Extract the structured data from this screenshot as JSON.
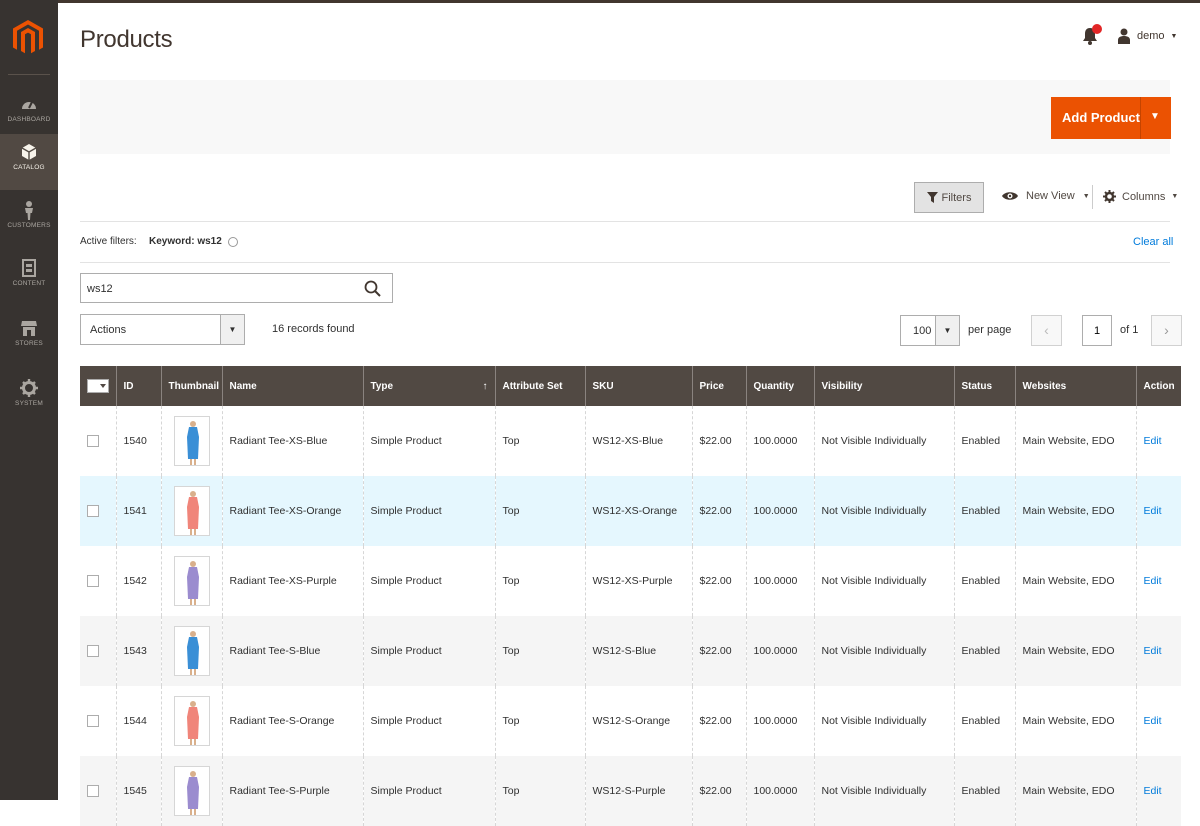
{
  "sidebar": {
    "items": [
      {
        "label": "DASHBOARD",
        "icon": "dashboard-icon",
        "active": false
      },
      {
        "label": "CATALOG",
        "icon": "catalog-icon",
        "active": true
      },
      {
        "label": "CUSTOMERS",
        "icon": "customers-icon",
        "active": false
      },
      {
        "label": "CONTENT",
        "icon": "content-icon",
        "active": false
      },
      {
        "label": "STORES",
        "icon": "stores-icon",
        "active": false
      },
      {
        "label": "SYSTEM",
        "icon": "system-icon",
        "active": false
      }
    ]
  },
  "header": {
    "title": "Products",
    "user": "demo"
  },
  "page_actions": {
    "add_product": "Add Product",
    "add_product_color": "#eb5202"
  },
  "toolbar": {
    "filters": "Filters",
    "view": "New View",
    "columns": "Columns"
  },
  "active_filters": {
    "label": "Active filters:",
    "filter_text": "Keyword: ws12",
    "clear_all": "Clear all"
  },
  "search": {
    "value": "ws12"
  },
  "grid_controls": {
    "actions": "Actions",
    "records": "16 records found",
    "per_page_value": "100",
    "per_page_label": "per page",
    "page_value": "1",
    "page_of": "of 1"
  },
  "table": {
    "columns": [
      "ID",
      "Thumbnail",
      "Name",
      "Type",
      "Attribute Set",
      "SKU",
      "Price",
      "Quantity",
      "Visibility",
      "Status",
      "Websites",
      "Action"
    ],
    "rows": [
      {
        "id": "1540",
        "color": "#3a8fd6",
        "name": "Radiant Tee-XS-Blue",
        "type": "Simple Product",
        "attr": "Top",
        "sku": "WS12-XS-Blue",
        "price": "$22.00",
        "qty": "100.0000",
        "visibility": "Not Visible Individually",
        "status": "Enabled",
        "websites": "Main Website, EDO",
        "action": "Edit"
      },
      {
        "id": "1541",
        "color": "#f0857a",
        "name": "Radiant Tee-XS-Orange",
        "type": "Simple Product",
        "attr": "Top",
        "sku": "WS12-XS-Orange",
        "price": "$22.00",
        "qty": "100.0000",
        "visibility": "Not Visible Individually",
        "status": "Enabled",
        "websites": "Main Website, EDO",
        "action": "Edit"
      },
      {
        "id": "1542",
        "color": "#9b8ccf",
        "name": "Radiant Tee-XS-Purple",
        "type": "Simple Product",
        "attr": "Top",
        "sku": "WS12-XS-Purple",
        "price": "$22.00",
        "qty": "100.0000",
        "visibility": "Not Visible Individually",
        "status": "Enabled",
        "websites": "Main Website, EDO",
        "action": "Edit"
      },
      {
        "id": "1543",
        "color": "#3a8fd6",
        "name": "Radiant Tee-S-Blue",
        "type": "Simple Product",
        "attr": "Top",
        "sku": "WS12-S-Blue",
        "price": "$22.00",
        "qty": "100.0000",
        "visibility": "Not Visible Individually",
        "status": "Enabled",
        "websites": "Main Website, EDO",
        "action": "Edit"
      },
      {
        "id": "1544",
        "color": "#f0857a",
        "name": "Radiant Tee-S-Orange",
        "type": "Simple Product",
        "attr": "Top",
        "sku": "WS12-S-Orange",
        "price": "$22.00",
        "qty": "100.0000",
        "visibility": "Not Visible Individually",
        "status": "Enabled",
        "websites": "Main Website, EDO",
        "action": "Edit"
      },
      {
        "id": "1545",
        "color": "#9b8ccf",
        "name": "Radiant Tee-S-Purple",
        "type": "Simple Product",
        "attr": "Top",
        "sku": "WS12-S-Purple",
        "price": "$22.00",
        "qty": "100.0000",
        "visibility": "Not Visible Individually",
        "status": "Enabled",
        "websites": "Main Website, EDO",
        "action": "Edit"
      }
    ]
  }
}
